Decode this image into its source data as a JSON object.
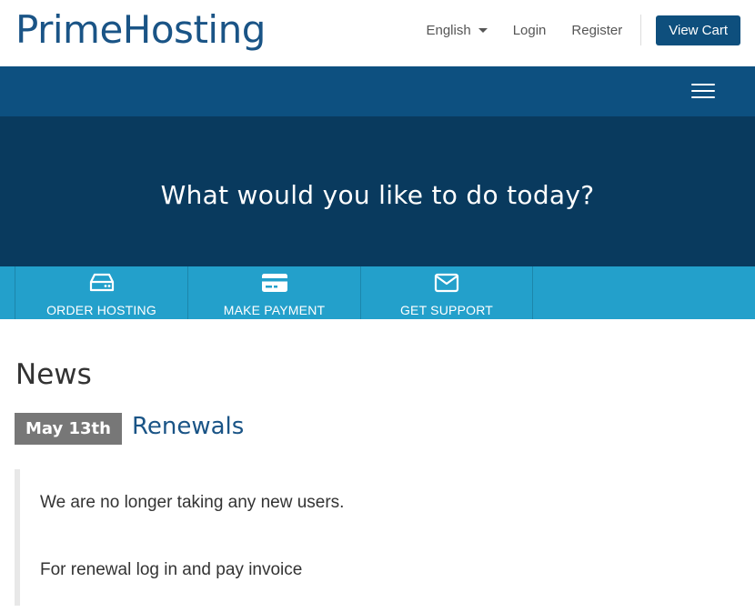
{
  "header": {
    "logo": "PrimeHosting",
    "language": "English",
    "login": "Login",
    "register": "Register",
    "view_cart": "View Cart"
  },
  "nav": {
    "menu_icon": "hamburger-menu-icon"
  },
  "hero": {
    "title": "What would you like to do today?"
  },
  "actions": [
    {
      "label": "ORDER HOSTING",
      "icon": "server-icon"
    },
    {
      "label": "MAKE PAYMENT",
      "icon": "credit-card-icon"
    },
    {
      "label": "GET SUPPORT",
      "icon": "envelope-icon"
    }
  ],
  "news": {
    "heading": "News",
    "items": [
      {
        "date": "May 13th",
        "title": "Renewals",
        "paragraphs": [
          "We are no longer taking any new users.",
          "For renewal log in and pay invoice"
        ]
      }
    ]
  },
  "colors": {
    "brand": "#1a5486",
    "nav_bg": "#0d5080",
    "hero_bg": "#093a5e",
    "action_bar": "#23a0cb",
    "cart_button": "#0e4f7d",
    "date_badge": "#777777"
  }
}
